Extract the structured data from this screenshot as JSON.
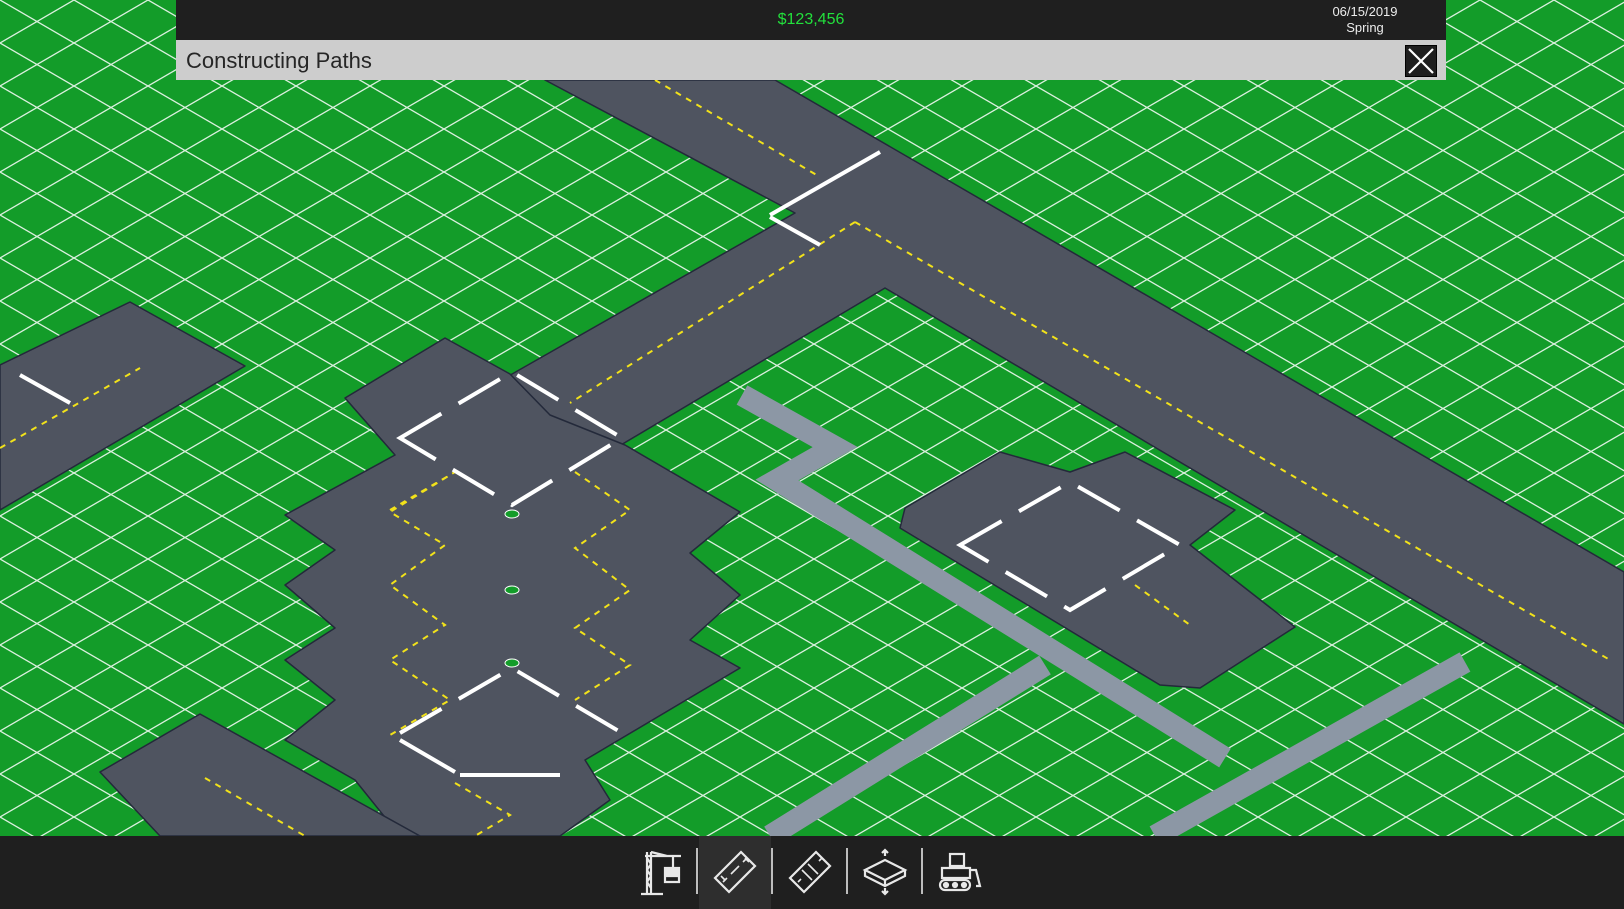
{
  "hud": {
    "money": "$123,456",
    "date": "06/15/2019",
    "season": "Spring"
  },
  "panel": {
    "title": "Constructing Paths",
    "close_icon": "close-icon"
  },
  "toolbar": {
    "tools": [
      {
        "icon": "construction-crane-icon",
        "active": false
      },
      {
        "icon": "runway-icon",
        "active": true
      },
      {
        "icon": "taxiway-icon",
        "active": false
      },
      {
        "icon": "foundation-icon",
        "active": false
      },
      {
        "icon": "bulldozer-icon",
        "active": false
      }
    ]
  },
  "colors": {
    "grass": "#139c29",
    "asphalt": "#4f5460",
    "path": "#8c97a5",
    "money": "#22e03c",
    "hud_bg": "#1f1f1f",
    "panel_bg": "#cdcdcd"
  }
}
